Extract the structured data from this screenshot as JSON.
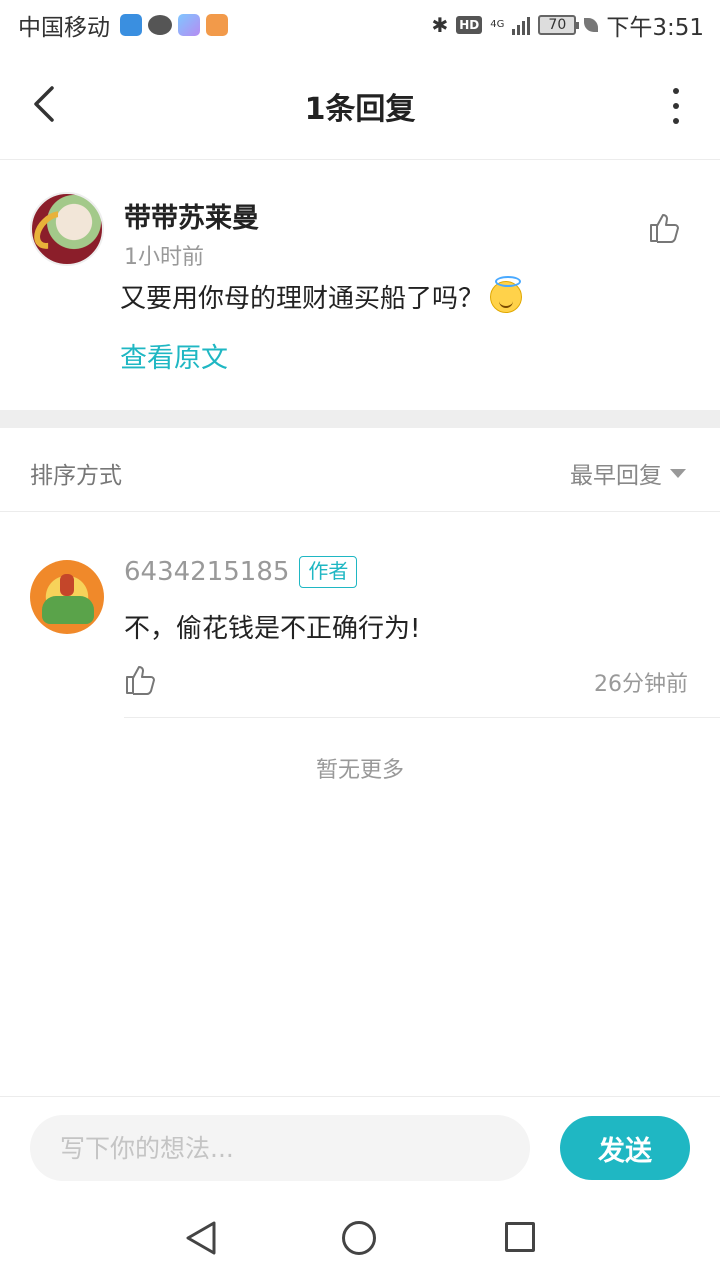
{
  "status_bar": {
    "carrier": "中国移动",
    "app_icons": [
      "shield-app-icon",
      "chat-app-icon",
      "game-app-icon",
      "video-app-icon"
    ],
    "bluetooth_icon": "bluetooth-icon",
    "hd": "HD",
    "network": "4G",
    "battery": "70",
    "time": "下午3:51"
  },
  "header": {
    "title": "1条回复",
    "back_icon": "chevron-left-icon",
    "more_icon": "more-vertical-icon"
  },
  "main_comment": {
    "author": "带带苏莱曼",
    "time": "1小时前",
    "text": "又要用你母的理财通买船了吗？",
    "emoji": "smiling-face-with-halo",
    "view_original": "查看原文",
    "like_icon": "thumbs-up-icon"
  },
  "sort": {
    "label": "排序方式",
    "selected": "最早回复"
  },
  "reply": {
    "user": "6434215185",
    "badge": "作者",
    "text": "不，偷花钱是不正确行为!",
    "time": "26分钟前",
    "like_icon": "thumbs-up-icon"
  },
  "footer_note": "暂无更多",
  "input": {
    "placeholder": "写下你的想法...",
    "value": "",
    "send_label": "发送"
  },
  "colors": {
    "accent": "#1fb7c3",
    "text_primary": "#222222",
    "text_secondary": "#999999"
  }
}
